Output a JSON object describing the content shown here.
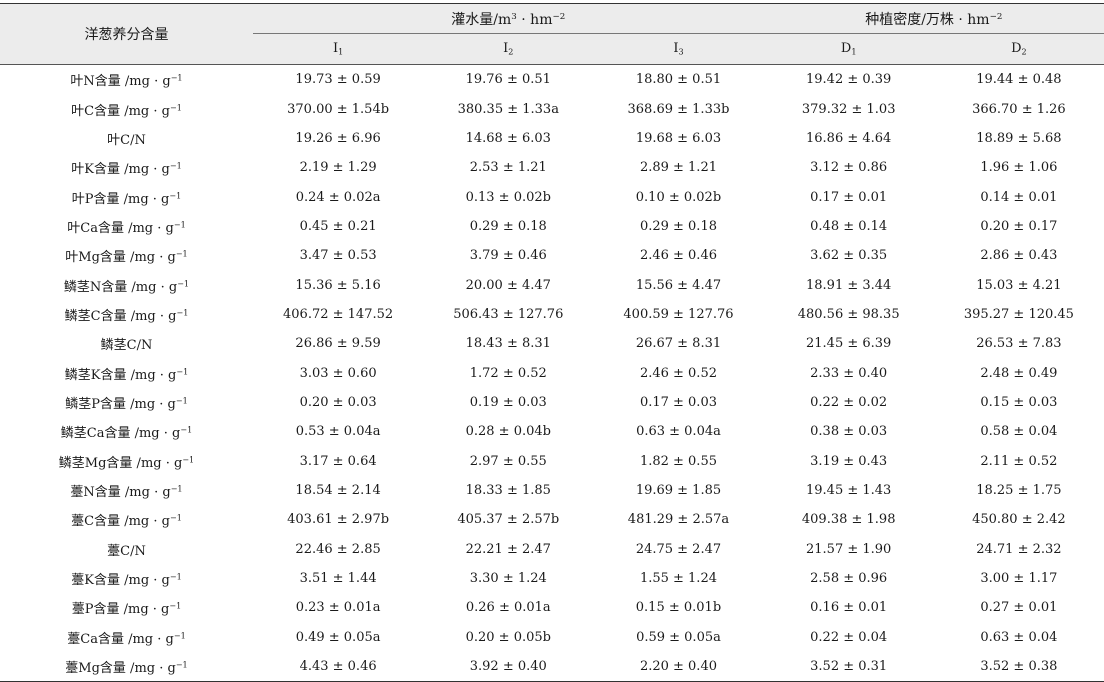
{
  "table": {
    "row_header": "洋葱养分含量",
    "groups": {
      "irrigation": {
        "label": "灌水量/m",
        "sup1": "3",
        "mid": " · hm",
        "sup2": "−2"
      },
      "density": {
        "label": "种植密度/万株 · hm",
        "sup": "−2"
      }
    },
    "subheaders": [
      {
        "base": "I",
        "sub": "1"
      },
      {
        "base": "I",
        "sub": "2"
      },
      {
        "base": "I",
        "sub": "3"
      },
      {
        "base": "D",
        "sub": "1"
      },
      {
        "base": "D",
        "sub": "2"
      }
    ],
    "rows": [
      {
        "label": "叶N含量 /mg · g",
        "sup": "−1",
        "values": [
          "19.73 ± 0.59",
          "19.76 ± 0.51",
          "18.80 ± 0.51",
          "19.42 ± 0.39",
          "19.44 ± 0.48"
        ]
      },
      {
        "label": "叶C含量 /mg · g",
        "sup": "−1",
        "values": [
          "370.00 ± 1.54b",
          "380.35 ± 1.33a",
          "368.69 ± 1.33b",
          "379.32 ± 1.03",
          "366.70 ± 1.26"
        ]
      },
      {
        "label": "叶C/N",
        "sup": "",
        "values": [
          "19.26 ± 6.96",
          "14.68 ± 6.03",
          "19.68 ± 6.03",
          "16.86 ± 4.64",
          "18.89 ± 5.68"
        ]
      },
      {
        "label": "叶K含量 /mg · g",
        "sup": "−1",
        "values": [
          "2.19 ± 1.29",
          "2.53 ± 1.21",
          "2.89 ± 1.21",
          "3.12 ± 0.86",
          "1.96 ± 1.06"
        ]
      },
      {
        "label": "叶P含量 /mg · g",
        "sup": "−1",
        "values": [
          "0.24 ± 0.02a",
          "0.13 ± 0.02b",
          "0.10 ± 0.02b",
          "0.17 ± 0.01",
          "0.14 ± 0.01"
        ]
      },
      {
        "label": "叶Ca含量 /mg · g",
        "sup": "−1",
        "values": [
          "0.45 ± 0.21",
          "0.29 ± 0.18",
          "0.29 ± 0.18",
          "0.48 ± 0.14",
          "0.20 ± 0.17"
        ]
      },
      {
        "label": "叶Mg含量 /mg · g",
        "sup": "−1",
        "values": [
          "3.47 ± 0.53",
          "3.79 ± 0.46",
          "2.46 ± 0.46",
          "3.62 ± 0.35",
          "2.86 ± 0.43"
        ]
      },
      {
        "label": "鳞茎N含量 /mg · g",
        "sup": "−1",
        "values": [
          "15.36 ± 5.16",
          "20.00 ± 4.47",
          "15.56 ± 4.47",
          "18.91 ± 3.44",
          "15.03 ± 4.21"
        ]
      },
      {
        "label": "鳞茎C含量 /mg · g",
        "sup": "−1",
        "values": [
          "406.72 ± 147.52",
          "506.43 ± 127.76",
          "400.59 ± 127.76",
          "480.56 ± 98.35",
          "395.27 ± 120.45"
        ]
      },
      {
        "label": "鳞茎C/N",
        "sup": "",
        "values": [
          "26.86 ± 9.59",
          "18.43 ± 8.31",
          "26.67 ± 8.31",
          "21.45 ± 6.39",
          "26.53 ± 7.83"
        ]
      },
      {
        "label": "鳞茎K含量 /mg · g",
        "sup": "−1",
        "values": [
          "3.03 ± 0.60",
          "1.72 ± 0.52",
          "2.46 ± 0.52",
          "2.33 ± 0.40",
          "2.48 ± 0.49"
        ]
      },
      {
        "label": "鳞茎P含量 /mg · g",
        "sup": "−1",
        "values": [
          "0.20 ± 0.03",
          "0.19 ± 0.03",
          "0.17 ± 0.03",
          "0.22 ± 0.02",
          "0.15 ± 0.03"
        ]
      },
      {
        "label": "鳞茎Ca含量 /mg · g",
        "sup": "−1",
        "values": [
          "0.53 ± 0.04a",
          "0.28 ± 0.04b",
          "0.63 ± 0.04a",
          "0.38 ± 0.03",
          "0.58 ± 0.04"
        ]
      },
      {
        "label": "鳞茎Mg含量 /mg · g",
        "sup": "−1",
        "values": [
          "3.17 ± 0.64",
          "2.97 ± 0.55",
          "1.82 ± 0.55",
          "3.19 ± 0.43",
          "2.11 ± 0.52"
        ]
      },
      {
        "label": "薹N含量 /mg · g",
        "sup": "−1",
        "values": [
          "18.54 ± 2.14",
          "18.33 ± 1.85",
          "19.69 ± 1.85",
          "19.45 ± 1.43",
          "18.25 ± 1.75"
        ]
      },
      {
        "label": "薹C含量 /mg · g",
        "sup": "−1",
        "values": [
          "403.61 ± 2.97b",
          "405.37 ± 2.57b",
          "481.29 ± 2.57a",
          "409.38 ± 1.98",
          "450.80 ± 2.42"
        ]
      },
      {
        "label": "薹C/N",
        "sup": "",
        "values": [
          "22.46 ± 2.85",
          "22.21 ± 2.47",
          "24.75 ± 2.47",
          "21.57 ± 1.90",
          "24.71 ± 2.32"
        ]
      },
      {
        "label": "薹K含量 /mg · g",
        "sup": "−1",
        "values": [
          "3.51 ± 1.44",
          "3.30 ± 1.24",
          "1.55 ± 1.24",
          "2.58 ± 0.96",
          "3.00 ± 1.17"
        ]
      },
      {
        "label": "薹P含量 /mg · g",
        "sup": "−1",
        "values": [
          "0.23 ± 0.01a",
          "0.26 ± 0.01a",
          "0.15 ± 0.01b",
          "0.16 ± 0.01",
          "0.27 ± 0.01"
        ]
      },
      {
        "label": "薹Ca含量 /mg · g",
        "sup": "−1",
        "values": [
          "0.49 ± 0.05a",
          "0.20 ± 0.05b",
          "0.59 ± 0.05a",
          "0.22 ± 0.04",
          "0.63 ± 0.04"
        ]
      },
      {
        "label": "薹Mg含量 /mg · g",
        "sup": "−1",
        "values": [
          "4.43 ± 0.46",
          "3.92 ± 0.40",
          "2.20 ± 0.40",
          "3.52 ± 0.31",
          "3.52 ± 0.38"
        ]
      }
    ]
  }
}
